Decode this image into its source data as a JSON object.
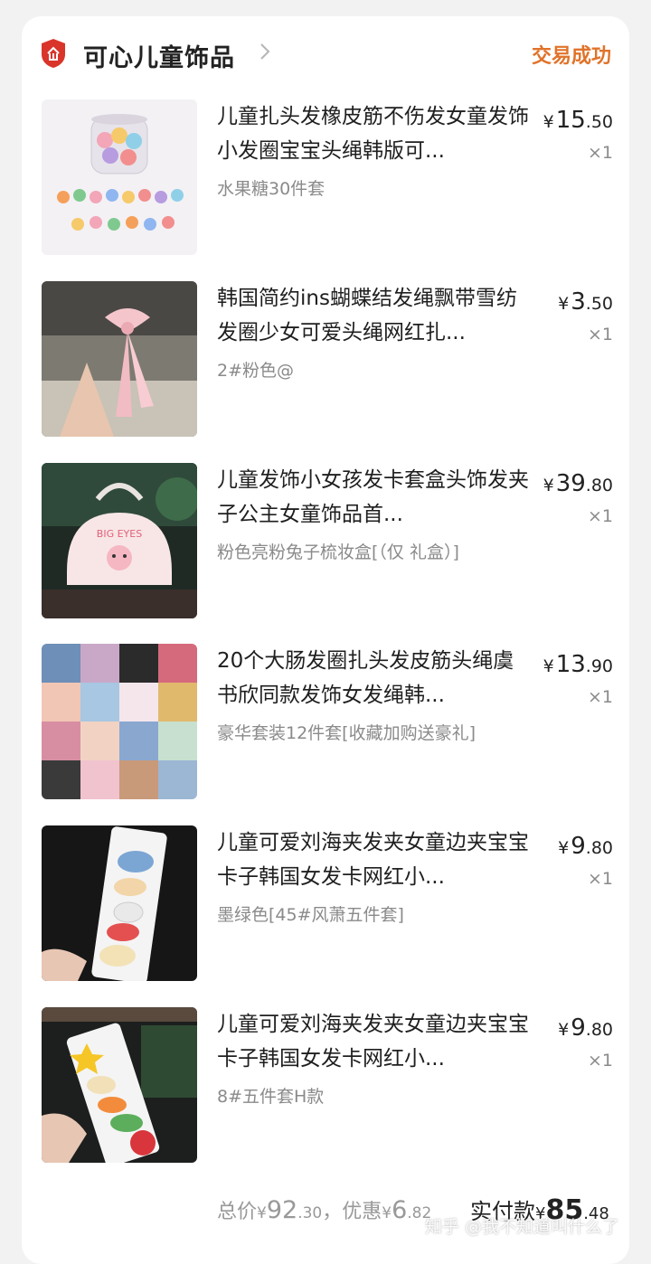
{
  "shop": {
    "name": "可心儿童饰品",
    "status": "交易成功"
  },
  "items": [
    {
      "title": "儿童扎头发橡皮筋不伤发女童发饰小发圈宝宝头绳韩版可...",
      "spec": "水果糖30件套",
      "price_int": "15",
      "price_dec": ".50",
      "qty": "×1"
    },
    {
      "title": "韩国简约ins蝴蝶结发绳飘带雪纺发圈少女可爱头绳网红扎...",
      "spec": "2#粉色@",
      "price_int": "3",
      "price_dec": ".50",
      "qty": "×1"
    },
    {
      "title": "儿童发饰小女孩发卡套盒头饰发夹子公主女童饰品首...",
      "spec": "粉色亮粉兔子梳妆盒[（仅 礼盒）]",
      "price_int": "39",
      "price_dec": ".80",
      "qty": "×1",
      "img_text": "BIG EYES"
    },
    {
      "title": "20个大肠发圈扎头发皮筋头绳虞书欣同款发饰女发绳韩...",
      "spec": "豪华套装12件套[收藏加购送豪礼]",
      "price_int": "13",
      "price_dec": ".90",
      "qty": "×1"
    },
    {
      "title": "儿童可爱刘海夹发夹女童边夹宝宝卡子韩国女发卡网红小...",
      "spec": "墨绿色[45#风萧五件套]",
      "price_int": "9",
      "price_dec": ".80",
      "qty": "×1"
    },
    {
      "title": "儿童可爱刘海夹发夹女童边夹宝宝卡子韩国女发卡网红小...",
      "spec": "8#五件套H款",
      "price_int": "9",
      "price_dec": ".80",
      "qty": "×1"
    }
  ],
  "currency": "¥",
  "footer": {
    "total_label": "总价",
    "total_int": "92",
    "total_dec": ".30",
    "discount_label": "，优惠",
    "discount_int": "6",
    "discount_dec": ".82",
    "paid_label": "实付款",
    "paid_int": "85",
    "paid_dec": ".48"
  },
  "watermark": "知乎 @我不知道叫什么了",
  "colors": {
    "status": "#e0732a",
    "shop_icon": "#d9352b"
  }
}
